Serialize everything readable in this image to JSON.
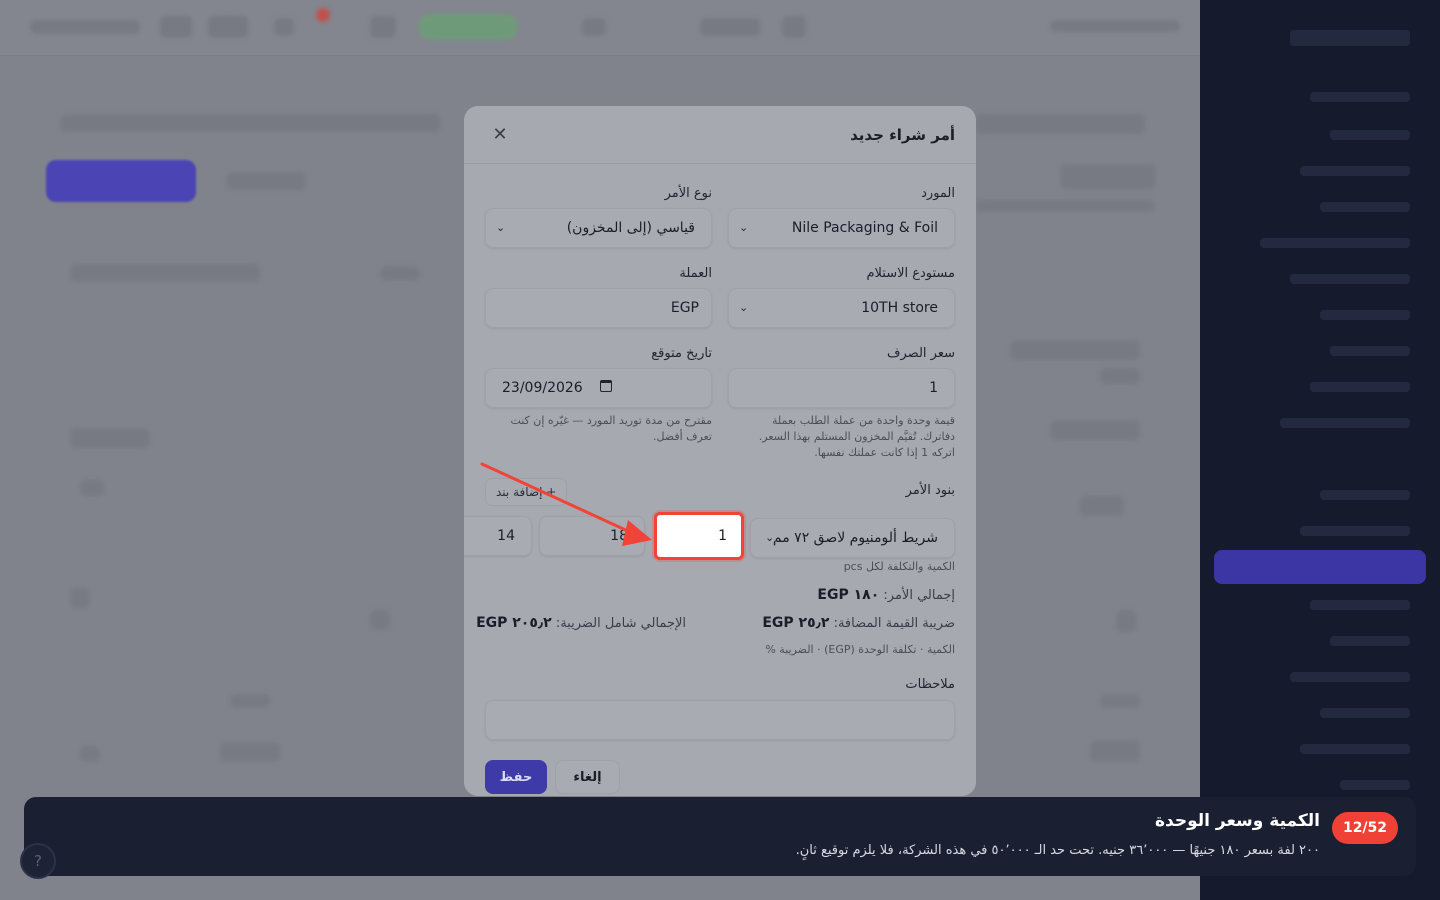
{
  "modal": {
    "title": "أمر شراء جديد",
    "close_glyph": "✕",
    "fields": {
      "supplier_label": "المورد",
      "supplier_value": "Nile Packaging & Foil",
      "order_type_label": "نوع الأمر",
      "order_type_value": "قياسي (إلى المخزون)",
      "warehouse_label": "مستودع الاستلام",
      "warehouse_value": "10TH store",
      "currency_label": "العملة",
      "currency_value": "EGP",
      "exchange_rate_label": "سعر الصرف",
      "exchange_rate_value": "1",
      "exchange_rate_hint": "قيمة وحدة واحدة من عملة الطلب بعملة دفاترك. تُقيَّم المخزون المستلم بهذا السعر. اتركه 1 إذا كانت عملتك نفسها.",
      "expected_date_label": "تاريخ متوقع",
      "expected_date_value": "23/09/2026",
      "expected_date_hint": "مقترح من مدة توريد المورد — غيّره إن كنت تعرف أفضل."
    },
    "lines": {
      "label": "بنود الأمر",
      "add_button": "+ إضافة بند",
      "item_value": "شريط ألومنيوم لاصق ٧٢ مم",
      "quantity_value": "1",
      "unit_cost_value": "18",
      "tax_value": "14",
      "hint": "الكمية والتكلفة لكل pcs"
    },
    "summary": {
      "total_label": "إجمالي الأمر:",
      "total_value": "EGP ١٨٠",
      "vat_label": "ضريبة القيمة المضافة:",
      "vat_value": "EGP ٢٥٫٢",
      "grand_label": "الإجمالي شامل الضريبة:",
      "grand_value": "EGP ٢٠٥٫٢",
      "columns_hint": "الكمية · تكلفة الوحدة (EGP) · الضريبة %"
    },
    "notes_label": "ملاحظات",
    "notes_value": "",
    "save_button": "حفظ",
    "cancel_button": "إلغاء"
  },
  "tour": {
    "step": "12/52",
    "title": "الكمية وسعر الوحدة",
    "text": "٢٠٠ لفة بسعر ١٨٠ جنيهًا — ٣٦٬٠٠٠ جنيه. تحت حد الـ ٥٠٬٠٠٠ في هذه الشركة، فلا يلزم توقيع ثانٍ."
  },
  "colors": {
    "accent": "#3e3aa8",
    "highlight": "#f04438",
    "tour_bg": "#1a1f31"
  },
  "icons": {
    "close": "close-icon",
    "chevron": "chevron-down-icon",
    "calendar": "calendar-icon",
    "help": "help-icon"
  }
}
